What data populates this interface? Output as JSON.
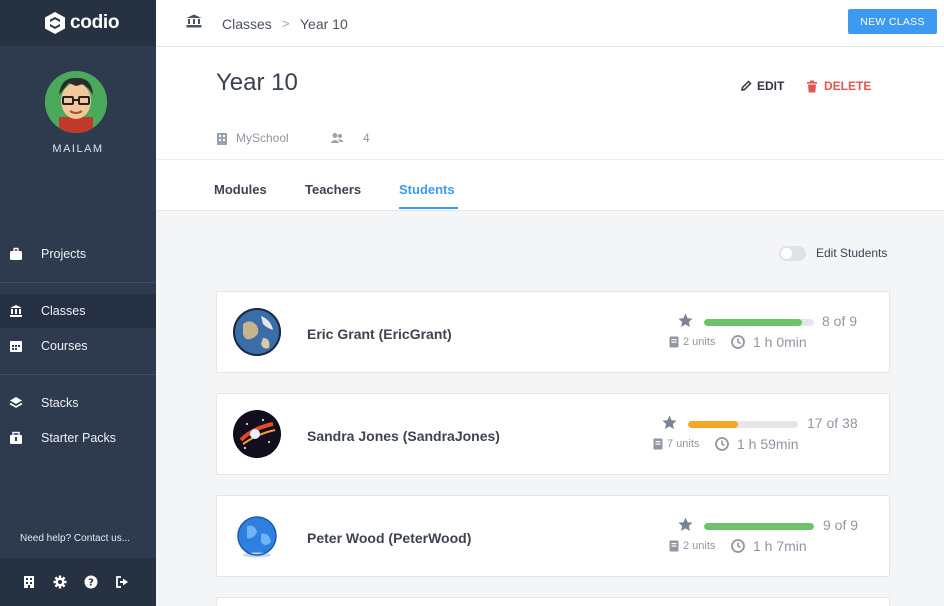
{
  "app": {
    "logo_text": "codio"
  },
  "user": {
    "name": "MAILAM"
  },
  "sidebar": {
    "items": [
      {
        "label": "Projects"
      },
      {
        "label": "Classes"
      },
      {
        "label": "Courses"
      },
      {
        "label": "Stacks"
      },
      {
        "label": "Starter Packs"
      }
    ],
    "help_text": "Need help? Contact us..."
  },
  "breadcrumb": {
    "parent": "Classes",
    "separator": ">",
    "current": "Year 10"
  },
  "toolbar": {
    "new_class_label": "NEW CLASS"
  },
  "page": {
    "title": "Year 10",
    "edit_label": "EDIT",
    "delete_label": "DELETE",
    "school": "MySchool",
    "teacher_count": "4"
  },
  "tabs": [
    {
      "label": "Modules"
    },
    {
      "label": "Teachers"
    },
    {
      "label": "Students"
    }
  ],
  "edit_students_label": "Edit Students",
  "students": [
    {
      "name": "Eric Grant (EricGrant)",
      "count_text": "8 of 9",
      "progress": 0.89,
      "units": "2 units",
      "time": "1 h 0min",
      "bar_color": "#6cc36a"
    },
    {
      "name": "Sandra Jones (SandraJones)",
      "count_text": "17 of 38",
      "progress": 0.45,
      "units": "7 units",
      "time": "1 h 59min",
      "bar_color": "#f5a623"
    },
    {
      "name": "Peter Wood (PeterWood)",
      "count_text": "9 of 9",
      "progress": 1.0,
      "units": "2 units",
      "time": "1 h 7min",
      "bar_color": "#6cc36a"
    }
  ],
  "colors": {
    "accent": "#3e9af0",
    "danger": "#e2564f",
    "sidebar": "#2e3a4d"
  }
}
